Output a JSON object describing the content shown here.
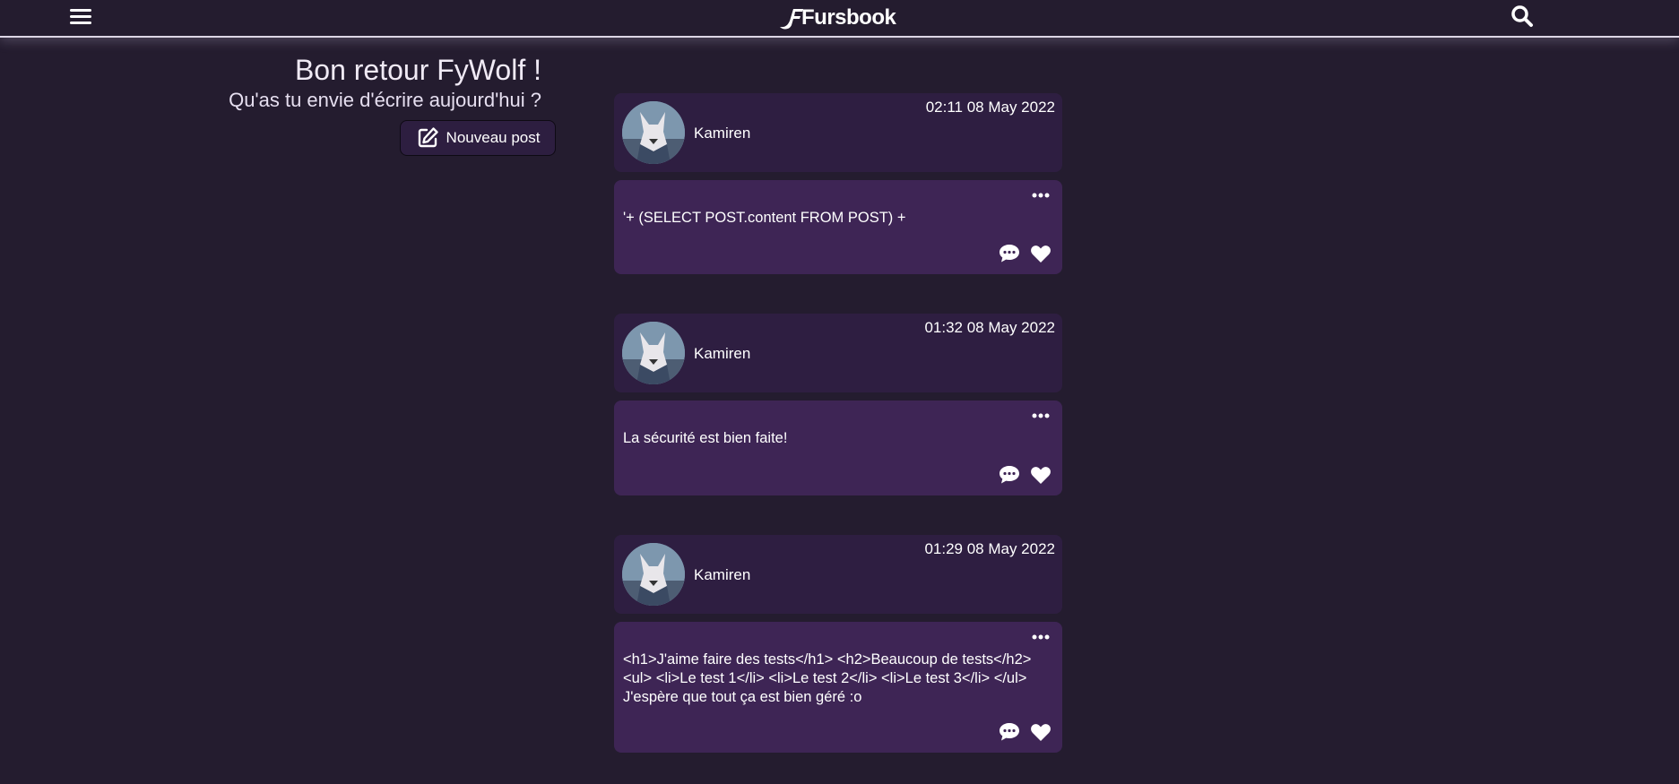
{
  "header": {
    "logo_text": "Fursbook",
    "menu_icon": "hamburger-menu-icon",
    "search_icon": "search-icon"
  },
  "welcome": {
    "title": "Bon retour FyWolf !",
    "subtitle": "Qu'as tu envie d'écrire aujourd'hui ?",
    "new_post_label": "Nouveau post"
  },
  "posts": [
    {
      "author": "Kamiren",
      "time": "02:11 08 May 2022",
      "content": "'+ (SELECT POST.content FROM POST) +"
    },
    {
      "author": "Kamiren",
      "time": "01:32 08 May 2022",
      "content": "La sécurité est bien faite!"
    },
    {
      "author": "Kamiren",
      "time": "01:29 08 May 2022",
      "content": "<h1>J'aime faire des tests</h1> <h2>Beaucoup de tests</h2> <ul> <li>Le test 1</li> <li>Le test 2</li> <li>Le test 3</li> </ul> J'espère que tout ça est bien géré :o"
    }
  ],
  "colors": {
    "background": "#241c2f",
    "post_header": "#2e1e41",
    "post_body": "#3e2555"
  }
}
